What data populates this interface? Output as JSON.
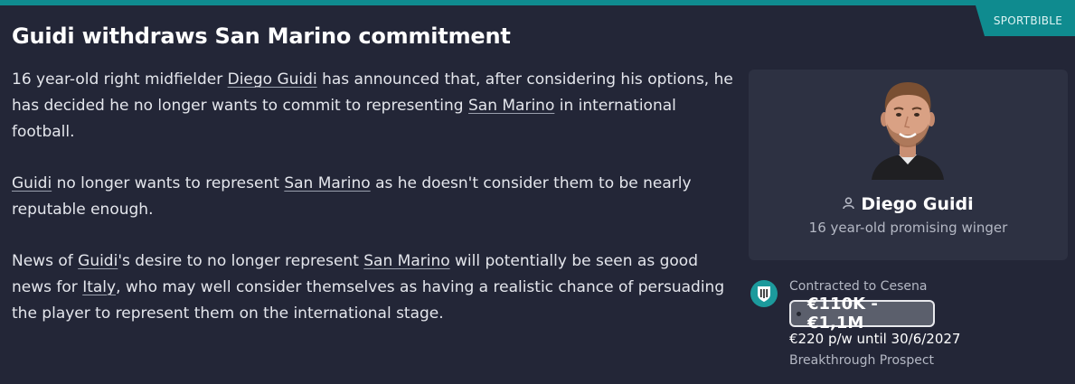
{
  "source": "SPORTBIBLE",
  "headline": "Guidi withdraws San Marino commitment",
  "article": {
    "p1": {
      "t1": "16 year-old right midfielder ",
      "link1": "Diego Guidi",
      "t2": " has announced that, after considering his options, he has decided he no longer wants to commit to representing ",
      "link2": "San Marino",
      "t3": " in international football."
    },
    "p2": {
      "link1": "Guidi",
      "t1": " no longer wants to represent ",
      "link2": "San Marino",
      "t2": " as he doesn't consider them to be nearly reputable enough."
    },
    "p3": {
      "t1": "News of ",
      "link1": "Guidi",
      "t2": "'s desire to no longer represent ",
      "link2": "San Marino",
      "t3": " will potentially be seen as good news for ",
      "link3": "Italy",
      "t4": ", who may well consider themselves as having a realistic chance of persuading the player to represent them on the international stage."
    }
  },
  "player": {
    "name": "Diego Guidi",
    "description": "16 year-old promising winger",
    "person_icon": "person-icon"
  },
  "contract": {
    "label": "Contracted to Cesena",
    "club_badge_icon": "club-badge-icon",
    "value_range": "€110K - €1,1M",
    "wage": "€220 p/w until 30/6/2027",
    "status": "Breakthrough Prospect"
  },
  "colors": {
    "accent": "#0f8b8f",
    "background": "#232637",
    "card": "#2d3142"
  }
}
